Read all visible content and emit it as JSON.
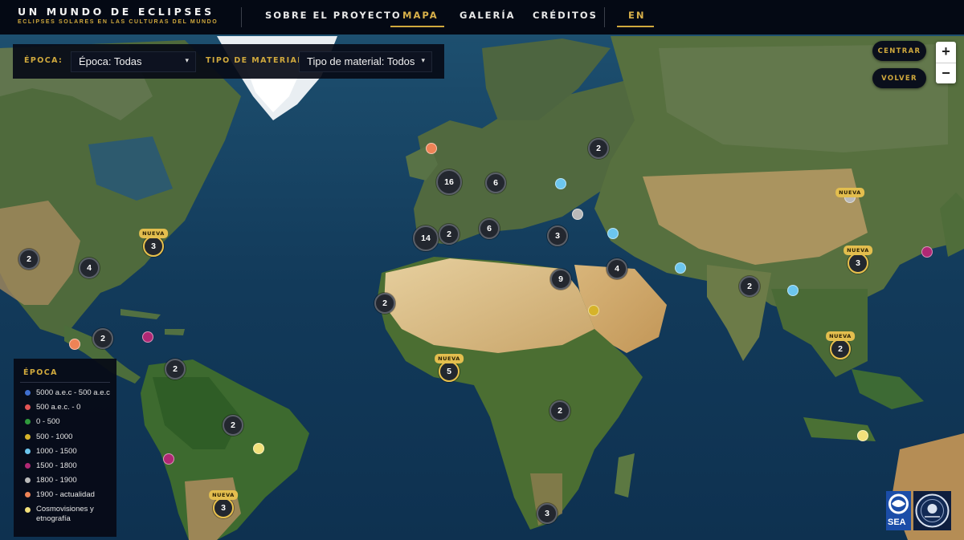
{
  "header": {
    "title": "UN MUNDO DE ECLIPSES",
    "subtitle": "ECLIPSES SOLARES EN LAS CULTURAS DEL MUNDO",
    "nav": {
      "about": "SOBRE EL PROYECTO",
      "map": "MAPA",
      "gallery": "GALERÍA",
      "credits": "CRÉDITOS",
      "lang": "EN"
    }
  },
  "filters": {
    "epoch_label": "ÉPOCA:",
    "epoch_value": "Época: Todas",
    "material_label": "TIPO DE MATERIAL:",
    "material_value": "Tipo de material: Todos"
  },
  "controls": {
    "center": "CENTRAR",
    "back": "VOLVER",
    "zoom_in": "+",
    "zoom_out": "−"
  },
  "legend": {
    "title": "ÉPOCA",
    "items": [
      {
        "label": "5000 a.e.c - 500 a.e.c",
        "color": "#3f6fd0"
      },
      {
        "label": "500 a.e.c. - 0",
        "color": "#e25555"
      },
      {
        "label": "0 - 500",
        "color": "#2f9a3c"
      },
      {
        "label": "500 - 1000",
        "color": "#d6b32a"
      },
      {
        "label": "1000 - 1500",
        "color": "#6cc6ee"
      },
      {
        "label": "1500 - 1800",
        "color": "#b02874"
      },
      {
        "label": "1800 - 1900",
        "color": "#b9b9b9"
      },
      {
        "label": "1900 - actualidad",
        "color": "#ee8356"
      },
      {
        "label": "Cosmovisiones y etnografía",
        "color": "#f2e07a"
      }
    ]
  },
  "badge_text": "NUEVA",
  "logos": {
    "sea": "SEA"
  },
  "clusters": [
    {
      "count": "2",
      "new": false
    },
    {
      "count": "4",
      "new": false
    },
    {
      "count": "3",
      "new": true
    },
    {
      "count": "2",
      "new": false
    },
    {
      "count": "2",
      "new": false
    },
    {
      "count": "2",
      "new": false
    },
    {
      "count": "3",
      "new": true
    },
    {
      "count": "16",
      "new": false
    },
    {
      "count": "6",
      "new": false
    },
    {
      "count": "14",
      "new": false
    },
    {
      "count": "2",
      "new": false
    },
    {
      "count": "6",
      "new": false
    },
    {
      "count": "2",
      "new": false
    },
    {
      "count": "3",
      "new": false
    },
    {
      "count": "9",
      "new": false
    },
    {
      "count": "4",
      "new": false
    },
    {
      "count": "2",
      "new": false
    },
    {
      "count": "5",
      "new": true
    },
    {
      "count": "2",
      "new": false
    },
    {
      "count": "3",
      "new": false
    },
    {
      "count": "2",
      "new": false
    },
    {
      "count": "3",
      "new": true
    },
    {
      "count": "2",
      "new": true
    }
  ],
  "points": [
    {
      "epoch": "1900 - actualidad",
      "color": "#ee8356"
    },
    {
      "epoch": "1900 - actualidad",
      "color": "#ee8356"
    },
    {
      "epoch": "1500 - 1800",
      "color": "#b02874"
    },
    {
      "epoch": "1500 - 1800",
      "color": "#b02874"
    },
    {
      "epoch": "1500 - 1800",
      "color": "#b02874"
    },
    {
      "epoch": "Cosmovisiones y etnografía",
      "color": "#f2e07a"
    },
    {
      "epoch": "Cosmovisiones y etnografía",
      "color": "#f2e07a"
    },
    {
      "epoch": "1000 - 1500",
      "color": "#6cc6ee"
    },
    {
      "epoch": "1000 - 1500",
      "color": "#6cc6ee"
    },
    {
      "epoch": "1000 - 1500",
      "color": "#6cc6ee"
    },
    {
      "epoch": "1000 - 1500",
      "color": "#6cc6ee"
    },
    {
      "epoch": "1800 - 1900",
      "color": "#b9b9b9"
    },
    {
      "epoch": "500 - 1000",
      "color": "#d6b32a"
    },
    {
      "epoch": "1800 - 1900",
      "color": "#b9b9b9"
    }
  ]
}
